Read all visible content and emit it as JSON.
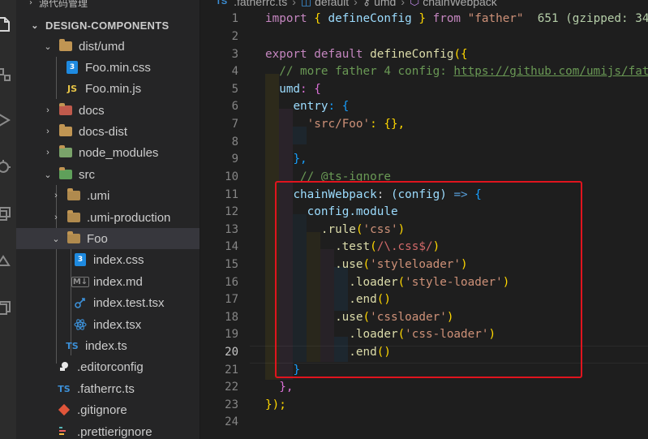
{
  "sidebar": {
    "header": "源代码管理",
    "project": "DESIGN-COMPONENTS",
    "items": [
      {
        "label": "dist/umd",
        "icon": "folder-open-icon",
        "expanded": true
      },
      {
        "label": "Foo.min.css",
        "icon": "css-file-icon"
      },
      {
        "label": "Foo.min.js",
        "icon": "js-file-icon",
        "icon_text": "JS"
      },
      {
        "label": "docs",
        "icon": "docs-folder-icon",
        "expanded": false
      },
      {
        "label": "docs-dist",
        "icon": "folder-icon",
        "expanded": false
      },
      {
        "label": "node_modules",
        "icon": "node-folder-icon",
        "expanded": false
      },
      {
        "label": "src",
        "icon": "src-folder-icon",
        "expanded": true
      },
      {
        "label": ".umi",
        "icon": "folder-icon",
        "expanded": false
      },
      {
        "label": ".umi-production",
        "icon": "folder-icon",
        "expanded": false
      },
      {
        "label": "Foo",
        "icon": "folder-open-icon",
        "expanded": true,
        "selected": true
      },
      {
        "label": "index.css",
        "icon": "css-file-icon"
      },
      {
        "label": "index.md",
        "icon": "markdown-file-icon",
        "icon_text": "M↓"
      },
      {
        "label": "index.test.tsx",
        "icon": "test-file-icon"
      },
      {
        "label": "index.tsx",
        "icon": "react-file-icon"
      },
      {
        "label": "index.ts",
        "icon": "ts-file-icon",
        "icon_text": "TS"
      },
      {
        "label": ".editorconfig",
        "icon": "editorconfig-icon"
      },
      {
        "label": ".fatherrc.ts",
        "icon": "ts-file-icon",
        "icon_text": "TS"
      },
      {
        "label": ".gitignore",
        "icon": "git-icon"
      },
      {
        "label": ".prettierignore",
        "icon": "prettier-icon"
      }
    ]
  },
  "breadcrumb": {
    "file_badge": "TS",
    "file": ".fatherrc.ts",
    "parts": [
      "default",
      "umd",
      "chainWebpack"
    ]
  },
  "editor": {
    "line_numbers": [
      "1",
      "2",
      "3",
      "4",
      "5",
      "6",
      "7",
      "8",
      "9",
      "10",
      "11",
      "12",
      "13",
      "14",
      "15",
      "16",
      "17",
      "18",
      "19",
      "20",
      "21",
      "22",
      "23",
      "24"
    ],
    "active_line": "20",
    "code": {
      "l1": {
        "import": "import",
        "brace_open": "{",
        "name": "defineConfig",
        "brace_close": "}",
        "from": "from",
        "module": "\"father\"",
        "size_hint": "651 (gzipped: 34"
      },
      "l3": {
        "export": "export",
        "default": "default",
        "fn": "defineConfig",
        "open": "({"
      },
      "l4": {
        "comment": "// more father 4 config: ",
        "url": "https://github.com/umijs/fat"
      },
      "l5": {
        "key": "umd",
        "rest": ": {"
      },
      "l6": {
        "key": "entry",
        "rest": ": {"
      },
      "l7": {
        "key": "'src/Foo'",
        "rest": ": {},"
      },
      "l9": {
        "text": "},"
      },
      "l10": {
        "comment": "// @ts-ignore"
      },
      "l11": {
        "key": "chainWebpack",
        "colon": ": ",
        "param": "(config)",
        "arrow": "=>",
        "brace": "{"
      },
      "l12": {
        "obj": "config",
        "prop": ".module"
      },
      "l13": {
        "method": ".rule",
        "arg": "'css'"
      },
      "l14": {
        "method": ".test",
        "regex": "/\\.css$/"
      },
      "l15": {
        "method": ".use",
        "arg": "'styleloader'"
      },
      "l16": {
        "method": ".loader",
        "arg": "'style-loader'"
      },
      "l17": {
        "method": ".end",
        "arg": "()"
      },
      "l18": {
        "method": ".use",
        "arg": "'cssloader'"
      },
      "l19": {
        "method": ".loader",
        "arg": "'css-loader'"
      },
      "l20": {
        "method": ".end",
        "arg": "()"
      },
      "l21": {
        "text": "}"
      },
      "l22": {
        "text": "},"
      },
      "l23": {
        "text": "});"
      }
    }
  },
  "colors": {
    "highlight_box": "#e0141e",
    "keyword": "#c586c0",
    "string": "#ce9178",
    "property": "#9cdcfe",
    "comment": "#6a9955"
  }
}
